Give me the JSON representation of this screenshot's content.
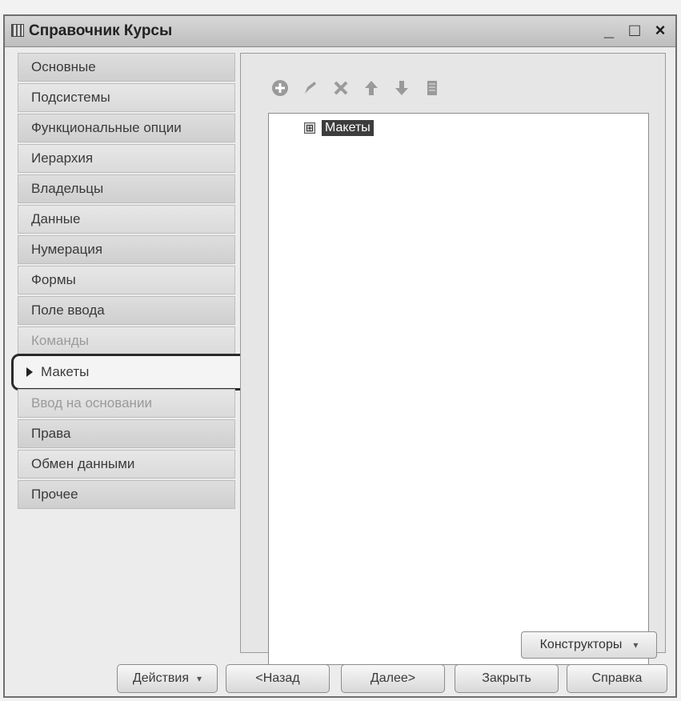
{
  "window": {
    "title": "Справочник Курсы",
    "controls": {
      "minimize": "_",
      "maximize": "□",
      "close": "×"
    }
  },
  "sidebar": {
    "items": [
      {
        "label": "Основные"
      },
      {
        "label": "Подсистемы"
      },
      {
        "label": "Функциональные опции"
      },
      {
        "label": "Иерархия"
      },
      {
        "label": "Владельцы"
      },
      {
        "label": "Данные"
      },
      {
        "label": "Нумерация"
      },
      {
        "label": "Формы"
      },
      {
        "label": "Поле ввода"
      },
      {
        "label": "Команды"
      },
      {
        "label": "Макеты"
      },
      {
        "label": "Ввод на основании"
      },
      {
        "label": "Права"
      },
      {
        "label": "Обмен данными"
      },
      {
        "label": "Прочее"
      }
    ],
    "selected_index": 10
  },
  "toolbar": {
    "icons": [
      "add-icon",
      "edit-icon",
      "delete-icon",
      "move-up-icon",
      "move-down-icon",
      "sort-icon"
    ]
  },
  "tree": {
    "root": {
      "label": "Макеты",
      "expand_symbol": "⊞"
    }
  },
  "constructors_button": {
    "label": "Конструкторы",
    "caret": "▾"
  },
  "bottom_bar": {
    "actions": "Действия",
    "back": "<Назад",
    "next": "Далее>",
    "close": "Закрыть",
    "help": "Справка"
  },
  "colors": {
    "selection_outline": "#2a2a2a",
    "tree_selection": "#3d3d3d"
  }
}
